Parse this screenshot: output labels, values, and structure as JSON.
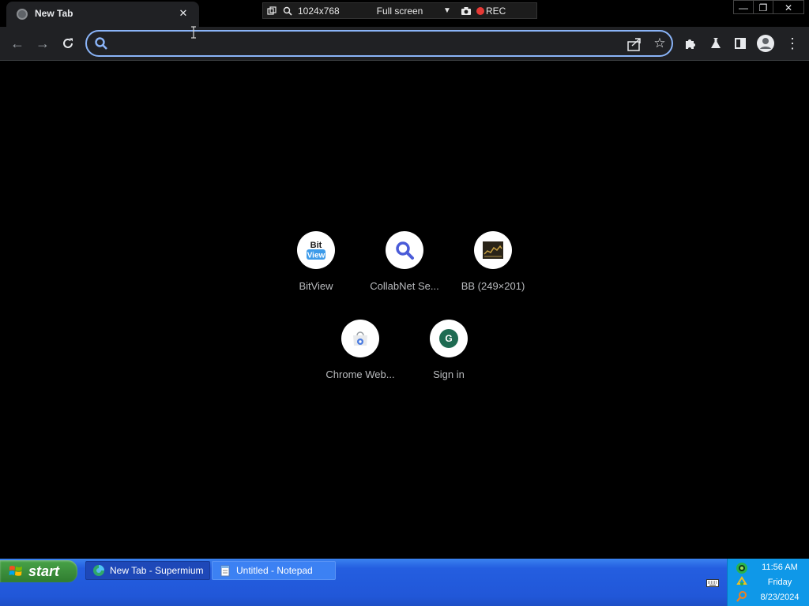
{
  "tab": {
    "title": "New Tab"
  },
  "recorder": {
    "resolution": "1024x768",
    "mode": "Full screen",
    "rec_label": "REC"
  },
  "omnibox": {
    "value": "",
    "placeholder": ""
  },
  "shortcuts": [
    {
      "label": "BitView",
      "icon": "bitview-logo"
    },
    {
      "label": "CollabNet Se...",
      "icon": "search-magnifier"
    },
    {
      "label": "BB (249×201)",
      "icon": "bb-thumbnail"
    },
    {
      "label": "Chrome Web...",
      "icon": "chrome-web-store"
    },
    {
      "label": "Sign in",
      "icon": "g-letter",
      "icon_text": "G"
    }
  ],
  "taskbar": {
    "start_label": "start",
    "tasks": [
      {
        "label": "New Tab - Supermium",
        "icon": "supermium-icon"
      },
      {
        "label": "Untitled - Notepad",
        "icon": "notepad-icon"
      }
    ],
    "tray": {
      "time": "11:56 AM",
      "day": "Friday",
      "date": "8/23/2024"
    }
  },
  "colors": {
    "accent": "#8ab4f8",
    "toolbar_bg": "#202124",
    "page_bg": "#000000",
    "taskbar_blue": "#245ee0",
    "tray_blue": "#0f98e8",
    "start_green": "#3c8f3c",
    "signin_green": "#1e6b52"
  }
}
